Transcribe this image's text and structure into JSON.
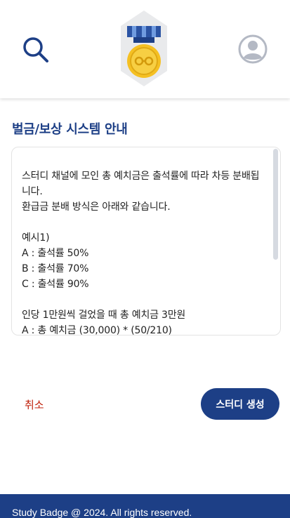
{
  "header": {
    "search_icon": "search-icon",
    "logo_icon": "medal-badge-logo",
    "profile_icon": "user-profile-icon"
  },
  "page_title": "벌금/보상 시스템 안내",
  "notice": {
    "lines": [
      "스터디 채널에 모인 총 예치금은 출석률에 따라 차등 분배됩니다.",
      "환급금 분배 방식은 아래와 같습니다.",
      "",
      "예시1)",
      "A : 출석률 50%",
      "B : 출석률 70%",
      "C : 출석률 90%",
      "",
      "인당 1만원씩 걸었을 때 총 예치금 3만원",
      "A : 총 예치금 (30,000) * (50/210)"
    ]
  },
  "buttons": {
    "cancel_label": "취소",
    "create_label": "스터디 생성"
  },
  "footer": {
    "text": "Study Badge @ 2024. All rights reserved."
  },
  "colors": {
    "primary": "#1d3f86",
    "cancel": "#c0220c",
    "medal_gold": "#f5c023"
  }
}
